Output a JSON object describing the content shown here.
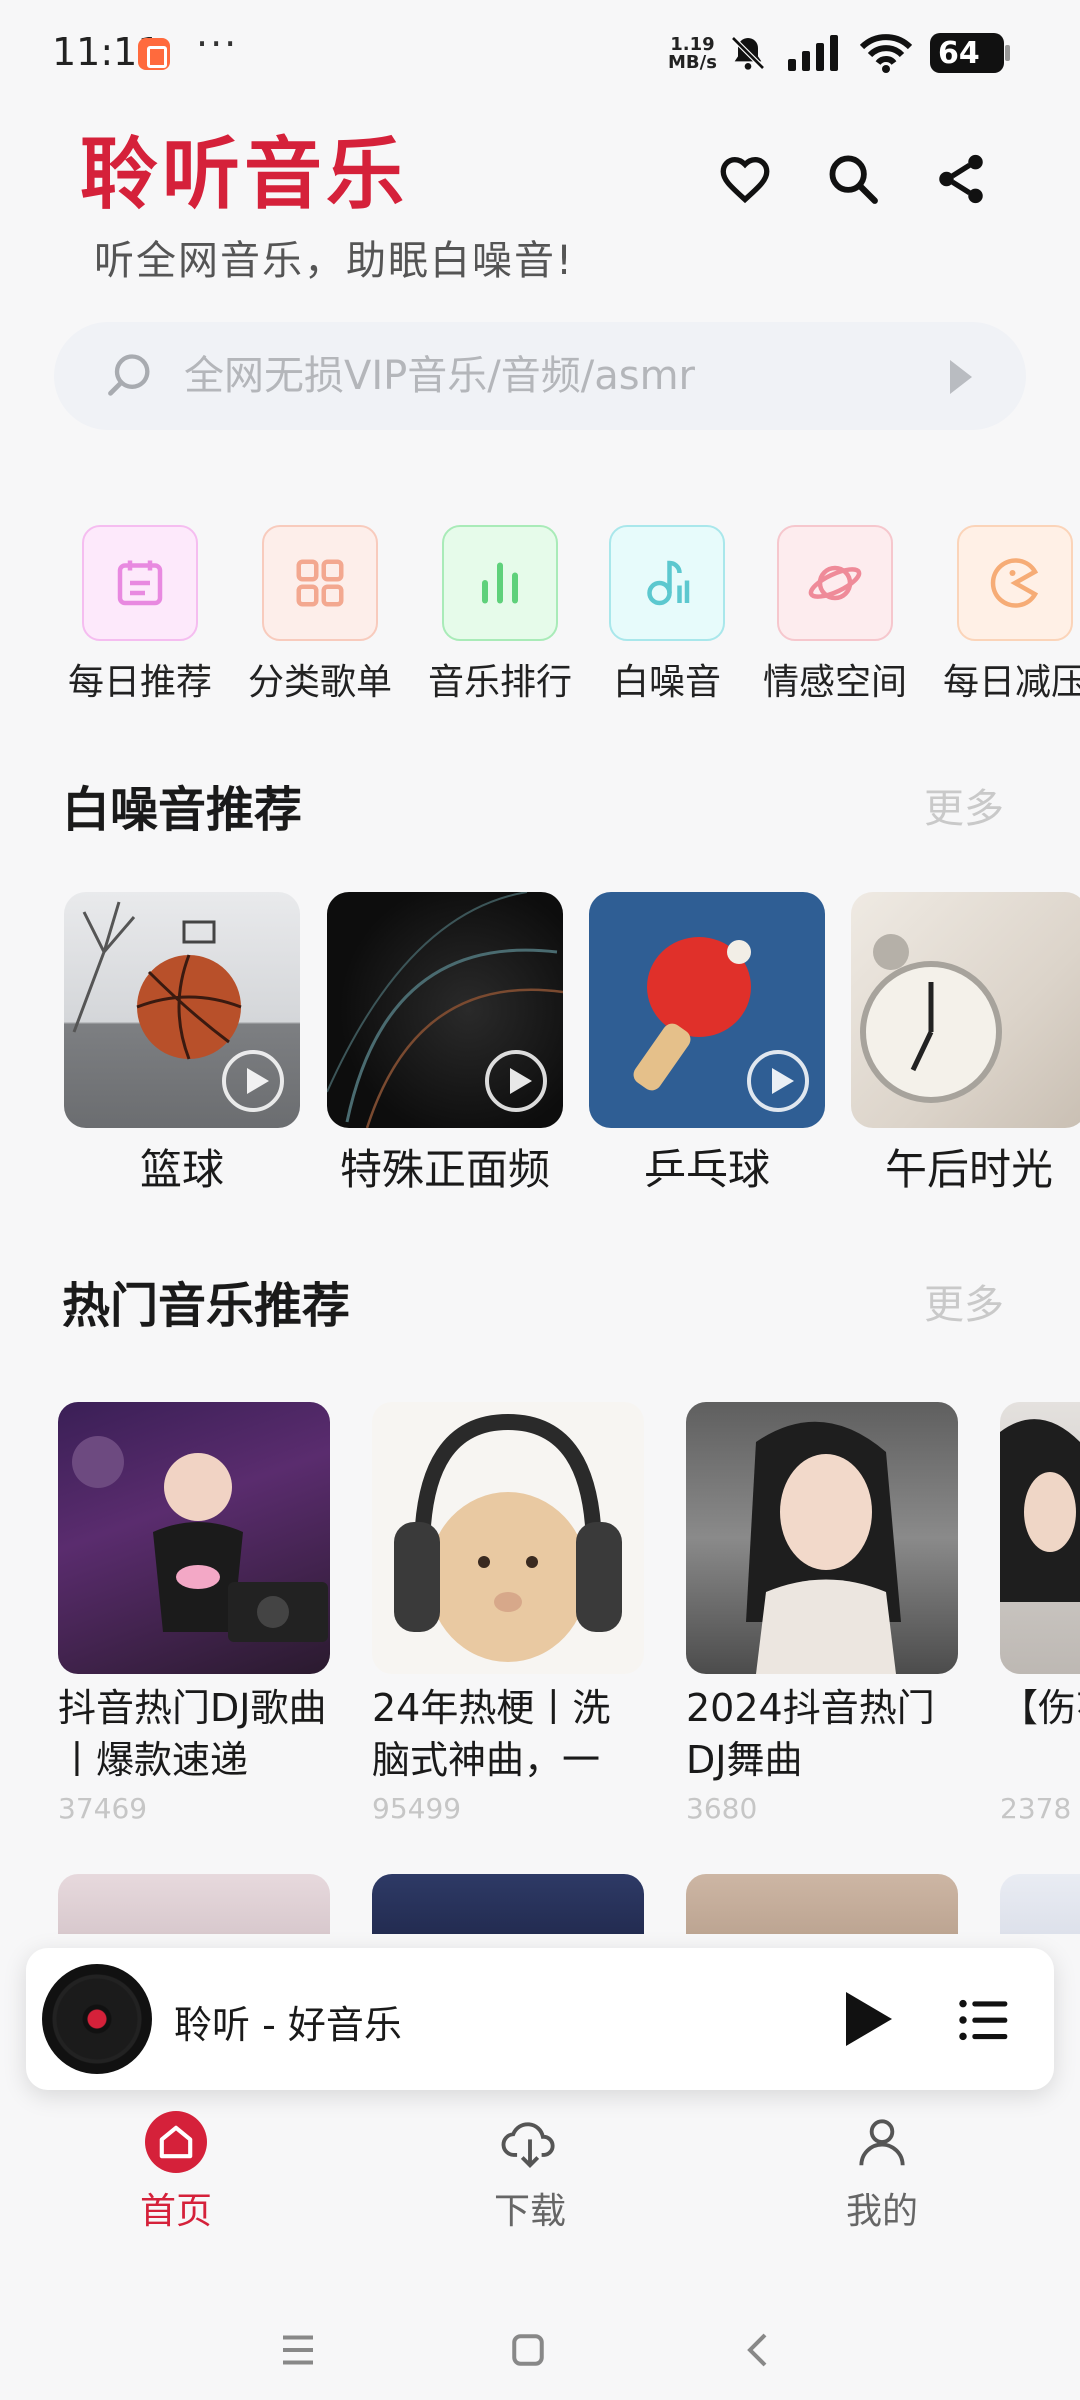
{
  "status_bar": {
    "time": "11:11",
    "more": "···",
    "net_speed_value": "1.19",
    "net_speed_unit": "MB/s",
    "battery": "64"
  },
  "header": {
    "title": "聆听音乐",
    "subtitle": "听全网音乐，助眠白噪音!"
  },
  "search": {
    "placeholder": "全网无损VIP音乐/音频/asmr"
  },
  "categories": [
    {
      "label": "每日推荐",
      "icon": "calendar-icon",
      "bg": "#fde9fb",
      "border": "#f5bdf0",
      "fg": "#e889e0"
    },
    {
      "label": "分类歌单",
      "icon": "grid-icon",
      "bg": "#fdeeea",
      "border": "#f8cbbd",
      "fg": "#f3a890"
    },
    {
      "label": "音乐排行",
      "icon": "bar-chart-icon",
      "bg": "#e6fbea",
      "border": "#a9ebb8",
      "fg": "#5fd17b"
    },
    {
      "label": "白噪音",
      "icon": "music-note-icon",
      "bg": "#e7fbfb",
      "border": "#a9e7eb",
      "fg": "#5cc8cf"
    },
    {
      "label": "情感空间",
      "icon": "planet-icon",
      "bg": "#fdecee",
      "border": "#f6c7cd",
      "fg": "#ef8b99"
    },
    {
      "label": "每日减压",
      "icon": "pacman-icon",
      "bg": "#fff0e6",
      "border": "#fbd4b9",
      "fg": "#f6ac76"
    }
  ],
  "noise_section": {
    "title": "白噪音推荐",
    "more": "更多",
    "items": [
      {
        "label": "篮球"
      },
      {
        "label": "特殊正面频"
      },
      {
        "label": "乒乓球"
      },
      {
        "label": "午后时光"
      }
    ]
  },
  "hot_section": {
    "title": "热门音乐推荐",
    "more": "更多",
    "items": [
      {
        "title": "抖音热门DJ歌曲丨爆款速递",
        "count": "37469"
      },
      {
        "title": "24年热梗丨洗脑式神曲，一",
        "count": "95499"
      },
      {
        "title": "2024抖音热门DJ舞曲",
        "count": "3680"
      },
      {
        "title": "【伤花板",
        "count": "2378"
      }
    ]
  },
  "player": {
    "title": "聆听 - 好音乐"
  },
  "tabs": [
    {
      "label": "首页"
    },
    {
      "label": "下载"
    },
    {
      "label": "我的"
    }
  ],
  "colors": {
    "brand": "#d5213a",
    "more_text": "#c9c9c9",
    "count_text": "#c6c6c6"
  }
}
